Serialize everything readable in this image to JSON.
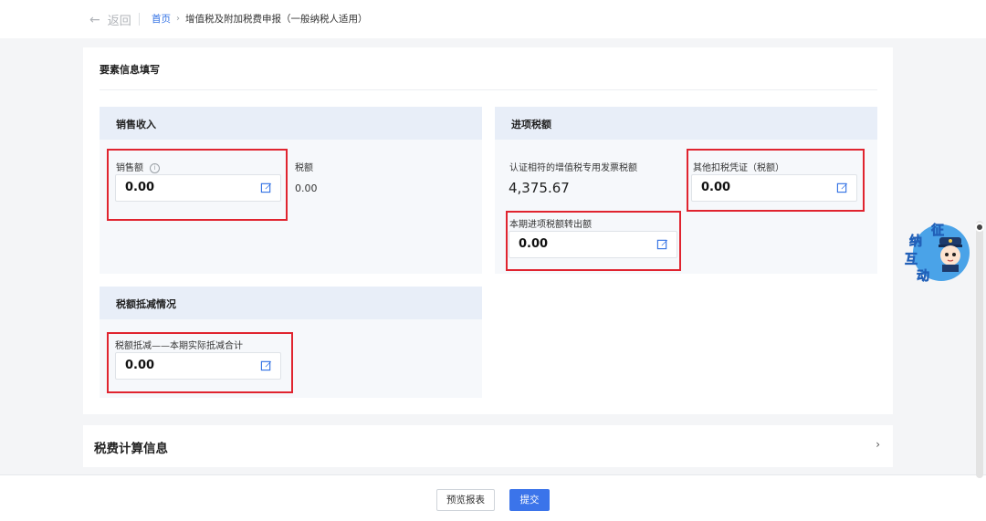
{
  "header": {
    "back_label": "返回",
    "breadcrumb_home": "首页",
    "breadcrumb_separator": "›",
    "breadcrumb_current": "增值税及附加税费申报（一般纳税人适用）"
  },
  "main": {
    "title": "要素信息填写",
    "sales": {
      "title": "销售收入",
      "amount_label": "销售额",
      "amount_value": "0.00",
      "tax_label": "税额",
      "tax_value": "0.00"
    },
    "input_tax": {
      "title": "进项税额",
      "certified_label": "认证相符的增值税专用发票税额",
      "certified_value": "4,375.67",
      "other_label": "其他扣税凭证（税额）",
      "other_value": "0.00",
      "transfer_label": "本期进项税额转出额",
      "transfer_value": "0.00"
    },
    "deduction": {
      "title": "税额抵减情况",
      "label": "税额抵减——本期实际抵减合计",
      "value": "0.00"
    }
  },
  "calc_section": {
    "title": "税费计算信息",
    "chevron": "›"
  },
  "footer": {
    "preview_label": "预览报表",
    "submit_label": "提交"
  },
  "widget": {
    "chars": [
      "征",
      "纳",
      "互",
      "动"
    ]
  },
  "icons": {
    "back": "arrow-left-icon",
    "info": "info-icon",
    "edit": "edit-icon"
  },
  "colors": {
    "accent": "#3b74ea",
    "link": "#2f6fe4",
    "highlight": "#e0242f",
    "section_header": "#e8eef8"
  }
}
